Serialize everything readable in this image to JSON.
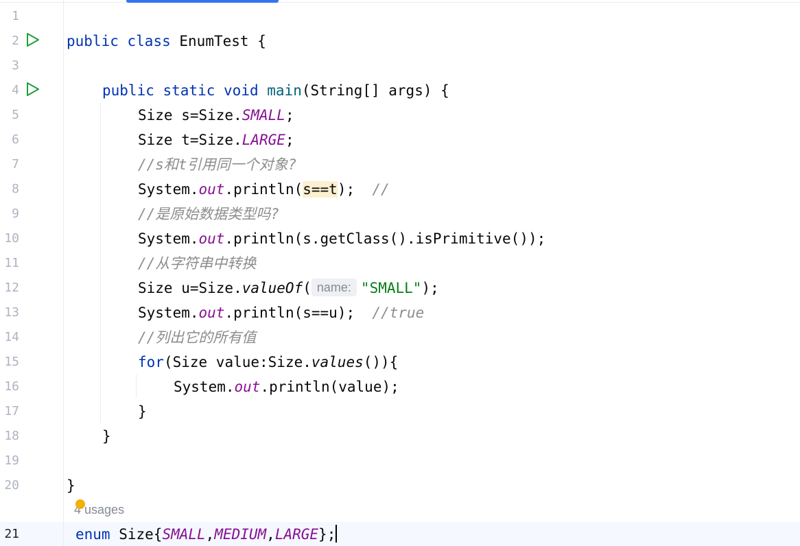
{
  "editor": {
    "line_numbers": [
      "1",
      "2",
      "3",
      "4",
      "5",
      "6",
      "7",
      "8",
      "9",
      "10",
      "11",
      "12",
      "13",
      "14",
      "15",
      "16",
      "17",
      "18",
      "19",
      "20",
      "21"
    ],
    "inlay_hint_name": "name:",
    "usages_label": "4 usages",
    "colors": {
      "keyword": "#0033b3",
      "method": "#00627a",
      "enum_constant": "#871094",
      "string": "#067d17",
      "comment": "#8c8c8c",
      "run_icon": "#1e9e3a",
      "scroll_tab": "#3574f0"
    }
  },
  "code": {
    "l2": {
      "kw1": "public",
      "kw2": "class",
      "name": "EnumTest",
      "brace": " {"
    },
    "l4": {
      "kw1": "public",
      "kw2": "static",
      "kw3": "void",
      "method": "main",
      "params": "(String[] args) {"
    },
    "l5": {
      "pre": "Size s=Size.",
      "const": "SMALL",
      "post": ";"
    },
    "l6": {
      "pre": "Size t=Size.",
      "const": "LARGE",
      "post": ";"
    },
    "l7": {
      "comment": "//s和t引用同一个对象?"
    },
    "l8": {
      "pre": "System.",
      "field": "out",
      "mid": ".println(",
      "hl": "s==t",
      "post": ");  ",
      "comment": "//"
    },
    "l9": {
      "comment": "//是原始数据类型吗?"
    },
    "l10": {
      "pre": "System.",
      "field": "out",
      "post": ".println(s.getClass().isPrimitive());"
    },
    "l11": {
      "comment": "//从字符串中转换"
    },
    "l12": {
      "pre": "Size u=Size.",
      "method": "valueOf",
      "paren": "(",
      "str": "\"SMALL\"",
      "post": ");"
    },
    "l13": {
      "pre": "System.",
      "field": "out",
      "post": ".println(s==u);  ",
      "comment": "//true"
    },
    "l14": {
      "comment": "//列出它的所有值"
    },
    "l15": {
      "kw": "for",
      "pre": "(Size value:Size.",
      "method": "values",
      "post": "()){"
    },
    "l16": {
      "pre": "System.",
      "field": "out",
      "post": ".println(value);"
    },
    "l17": {
      "text": "}"
    },
    "l18": {
      "text": "}"
    },
    "l20": {
      "text": "}"
    },
    "l21": {
      "kw": "enum",
      "pre": " Size{",
      "c1": "SMALL",
      "c2": "MEDIUM",
      "c3": "LARGE",
      "comma": ",",
      "post": "};"
    }
  }
}
